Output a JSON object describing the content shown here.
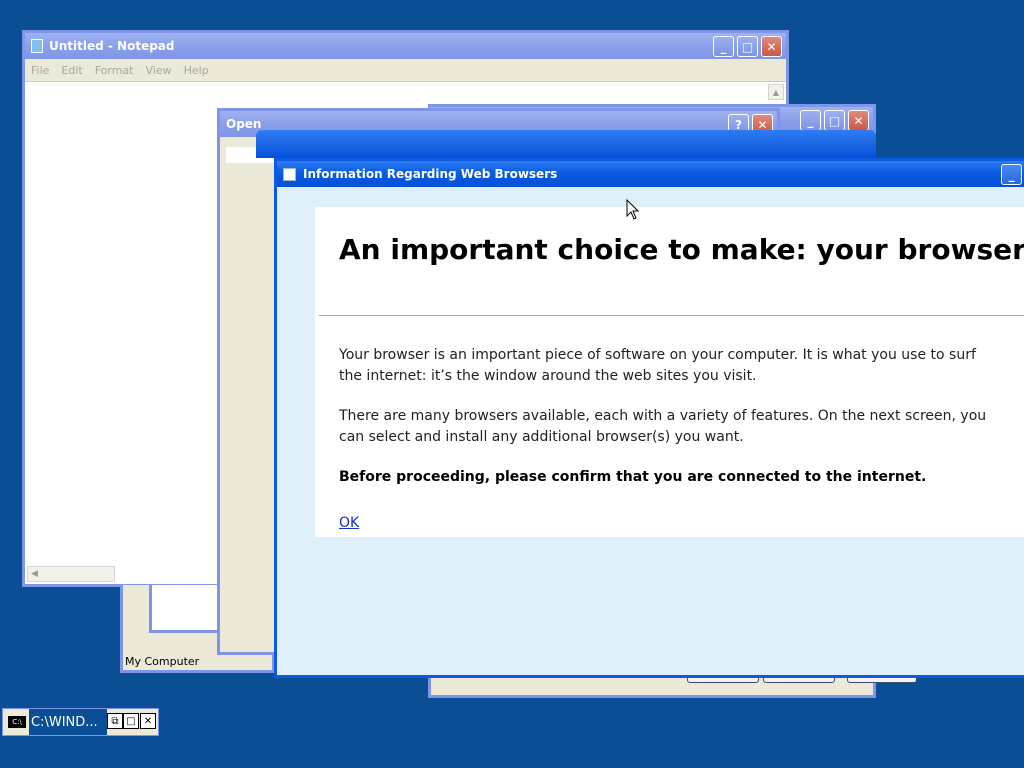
{
  "notepad": {
    "title": "Untitled - Notepad",
    "menu": [
      "File",
      "Edit",
      "Format",
      "View",
      "Help"
    ]
  },
  "my_computer": {
    "status": "My Computer"
  },
  "open_dialog": {
    "title": "Open"
  },
  "info_dialog": {
    "title": "Information Regarding Web Browsers",
    "heading": "An important choice to make: your browser",
    "para1": "Your browser is an important piece of software on your computer. It is what you use to surf the internet: it’s the window around the web sites you visit.",
    "para2": "There are many browsers available, each with a variety of features. On the next screen, you can select and install any additional browser(s) you want.",
    "para3": "Before proceeding, please confirm that you are connected to the internet.",
    "ok_label": "OK"
  },
  "cmd": {
    "title": "C:\\WIND..."
  },
  "colors": {
    "desktop": "#0a4e96",
    "active_titlebar": "#0650d8",
    "dialog_bg": "#dff0fb",
    "link": "#1a2ec0"
  }
}
